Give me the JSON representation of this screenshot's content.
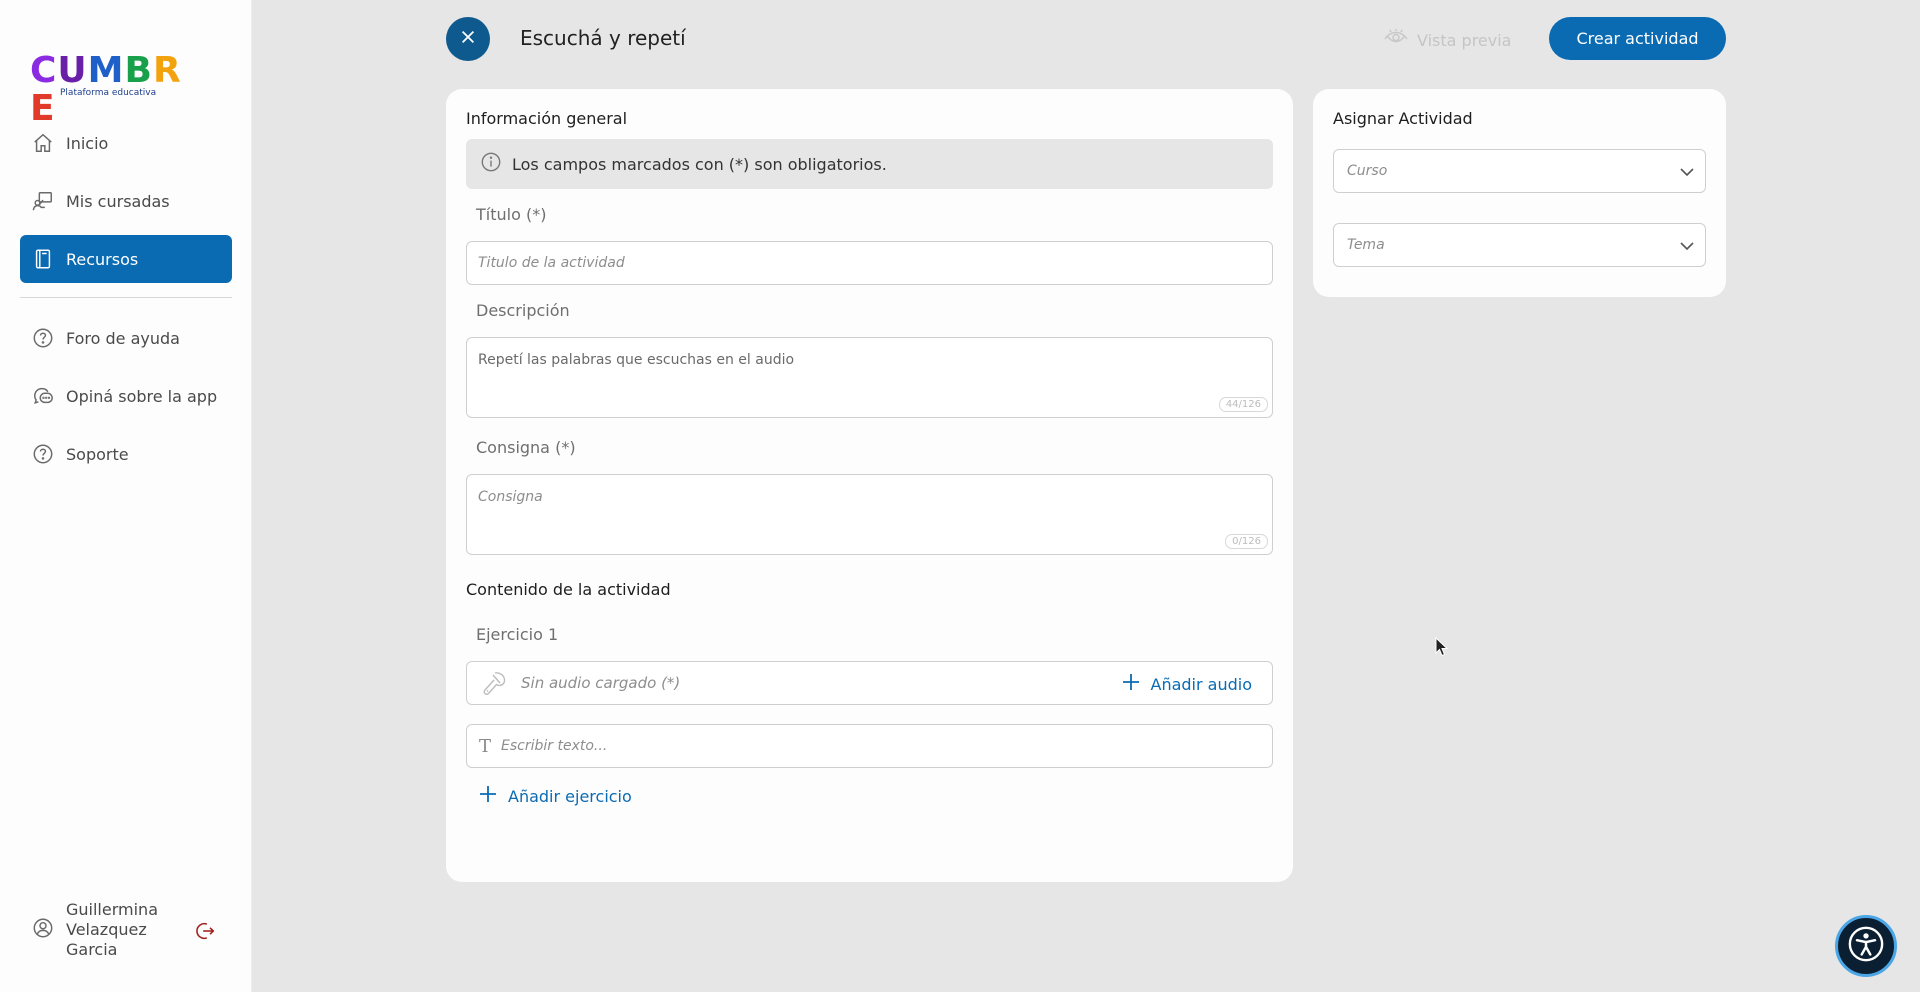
{
  "brand": {
    "logo_letters": [
      "C",
      "U",
      "M",
      "B",
      "R",
      "E"
    ],
    "logo_colors": [
      "#8a2be2",
      "#6a1fa8",
      "#1f5fc8",
      "#19a04a",
      "#f2a20c",
      "#e23a2a"
    ],
    "tagline": "Plataforma educativa"
  },
  "sidebar": {
    "items": [
      {
        "label": "Inicio",
        "icon": "home-icon",
        "active": false
      },
      {
        "label": "Mis cursadas",
        "icon": "teacher-board-icon",
        "active": false
      },
      {
        "label": "Recursos",
        "icon": "book-icon",
        "active": true
      },
      {
        "label": "Foro de ayuda",
        "icon": "help-circle-icon",
        "active": false
      },
      {
        "label": "Opiná sobre la app",
        "icon": "chat-bubbles-icon",
        "active": false
      },
      {
        "label": "Soporte",
        "icon": "help-circle-icon",
        "active": false
      }
    ],
    "user": {
      "name": "Guillermina Velazquez Garcia",
      "icon": "user-circle-icon"
    },
    "logout_icon": "logout-icon"
  },
  "header": {
    "title": "Escuchá y repetí",
    "preview_label": "Vista previa",
    "create_label": "Crear actividad"
  },
  "form": {
    "general_title": "Información general",
    "info_message": "Los campos marcados con (*) son obligatorios.",
    "title_label": "Título (*)",
    "title_placeholder": "Titulo de la actividad",
    "description_label": "Descripción",
    "description_value": "Repetí las palabras que escuchas en el audio",
    "description_counter": "44/126",
    "instruction_label": "Consigna (*)",
    "instruction_placeholder": "Consigna",
    "instruction_counter": "0/126",
    "content_title": "Contenido de la actividad",
    "exercise_label": "Ejercicio 1",
    "audio_status": "Sin audio cargado (*)",
    "add_audio_label": "Añadir audio",
    "text_placeholder": "Escribir texto...",
    "add_exercise_label": "Añadir ejercicio"
  },
  "assign": {
    "title": "Asignar Actividad",
    "course_placeholder": "Curso",
    "topic_placeholder": "Tema"
  },
  "colors": {
    "primary": "#0a6bb3",
    "close_button": "#0e5a8f",
    "logout": "#a0201e",
    "background": "#e6e6e6"
  }
}
